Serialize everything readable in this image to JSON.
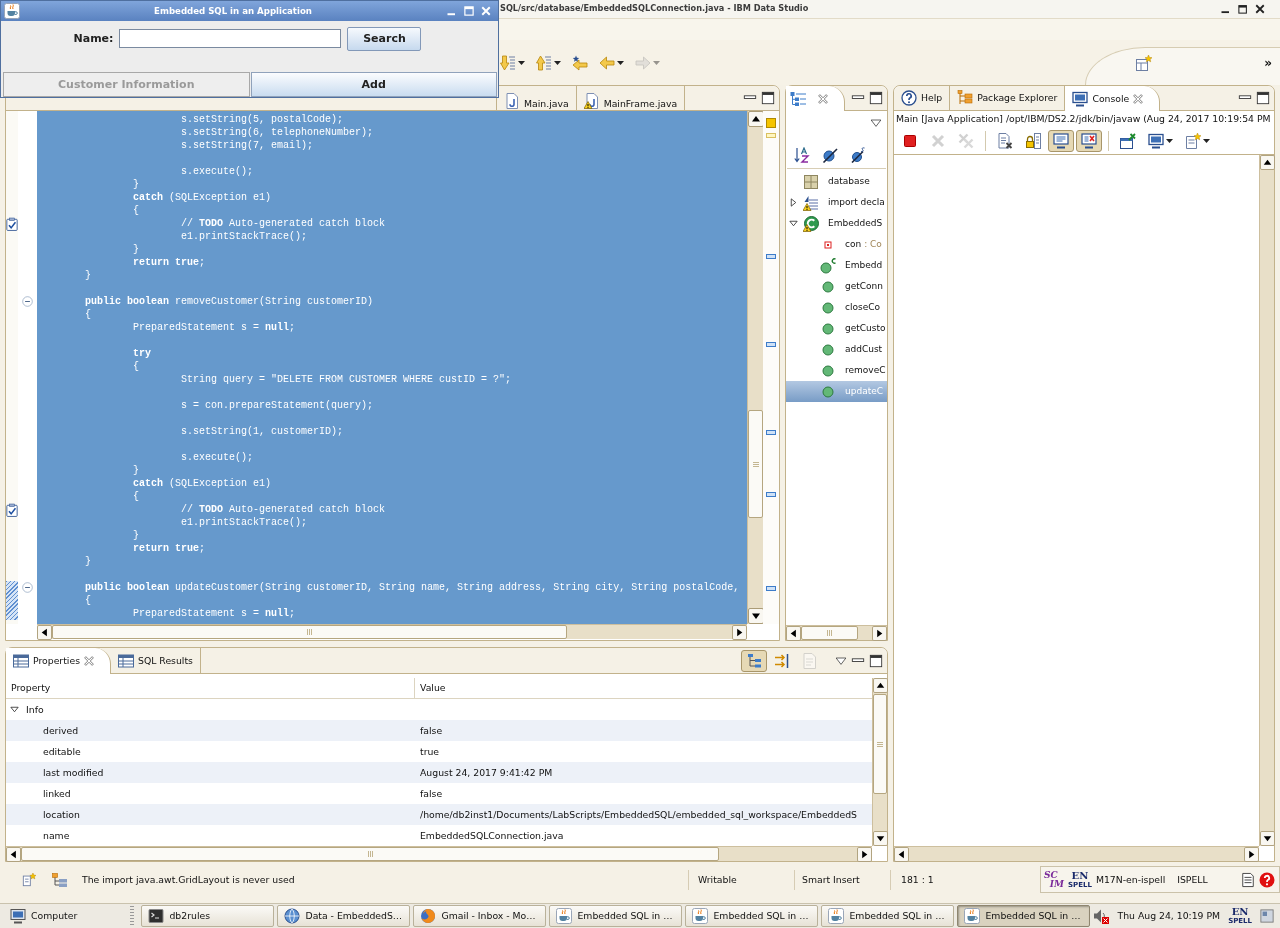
{
  "app_window": {
    "title": "Embedded SQL in an Application",
    "name_label": "Name:",
    "search_button": "Search",
    "buttons": [
      {
        "label": "Customer Information",
        "disabled": true
      },
      {
        "label": "Add",
        "disabled": false
      }
    ]
  },
  "ide": {
    "title": "SQL/src/database/EmbeddedSQLConnection.java - IBM Data Studio",
    "toolbar": [
      {
        "kind": "next-annotation",
        "dropdown": true,
        "disabled": false
      },
      {
        "kind": "previous-annotation",
        "dropdown": true,
        "disabled": false
      },
      {
        "kind": "last-edit",
        "dropdown": false,
        "disabled": false
      },
      {
        "kind": "back",
        "dropdown": true,
        "disabled": false
      },
      {
        "kind": "forward",
        "dropdown": true,
        "disabled": true
      }
    ],
    "overflow_label": "»"
  },
  "editor": {
    "tabs": [
      {
        "label": "Main.java",
        "selected": false,
        "warning": false
      },
      {
        "label": "MainFrame.java",
        "selected": false,
        "warning": true
      }
    ],
    "blocks": [
      {
        "changed": false,
        "lines": [
          {
            "kind": "code",
            "text": "\t\t\ts.setString(5, postalCode);"
          },
          {
            "kind": "code",
            "text": "\t\t\ts.setString(6, telephoneNumber);"
          },
          {
            "kind": "code",
            "text": "\t\t\ts.setString(7, email);"
          }
        ]
      },
      {
        "changed": false,
        "lines": [
          {
            "kind": "code",
            "text": "\t\t\ts.execute();"
          },
          {
            "kind": "code",
            "text": "\t\t}"
          },
          {
            "kind": "code",
            "text": "\t\t**catch** (SQLException e1)"
          },
          {
            "kind": "code",
            "text": "\t\t{"
          },
          {
            "kind": "task",
            "text": "\t\t\t// **TODO** Auto-generated catch block"
          },
          {
            "kind": "code",
            "text": "\t\t\te1.printStackTrace();"
          },
          {
            "kind": "code",
            "text": "\t\t}"
          },
          {
            "kind": "code",
            "text": "\t\t**return** **true**;"
          },
          {
            "kind": "code",
            "text": "\t}"
          }
        ]
      },
      {
        "changed": false,
        "lines": [
          {
            "kind": "fold",
            "text": "\t**public** **boolean** removeCustomer(String customerID)"
          },
          {
            "kind": "code",
            "text": "\t{"
          },
          {
            "kind": "code",
            "text": "\t\tPreparedStatement s = **null**;"
          }
        ]
      },
      {
        "changed": false,
        "lines": [
          {
            "kind": "code",
            "text": "\t\t**try**"
          },
          {
            "kind": "code",
            "text": "\t\t{"
          },
          {
            "kind": "code",
            "text": "\t\t\tString query = \"DELETE FROM CUSTOMER WHERE custID = ?\";"
          }
        ]
      },
      {
        "changed": false,
        "lines": [
          {
            "kind": "code",
            "text": "\t\t\ts = con.prepareStatement(query);"
          }
        ]
      },
      {
        "changed": false,
        "lines": [
          {
            "kind": "code",
            "text": "\t\t\ts.setString(1, customerID);"
          }
        ]
      },
      {
        "changed": false,
        "lines": [
          {
            "kind": "code",
            "text": "\t\t\ts.execute();"
          },
          {
            "kind": "code",
            "text": "\t\t}"
          },
          {
            "kind": "code",
            "text": "\t\t**catch** (SQLException e1)"
          },
          {
            "kind": "code",
            "text": "\t\t{"
          },
          {
            "kind": "task",
            "text": "\t\t\t// **TODO** Auto-generated catch block"
          },
          {
            "kind": "code",
            "text": "\t\t\te1.printStackTrace();"
          },
          {
            "kind": "code",
            "text": "\t\t}"
          },
          {
            "kind": "code",
            "text": "\t\t**return** **true**;"
          },
          {
            "kind": "code",
            "text": "\t}"
          }
        ]
      },
      {
        "changed": true,
        "lines": [
          {
            "kind": "fold",
            "text": "\t**public** **boolean** updateCustomer(String customerID, String name, String address, String city, String postalCode,"
          },
          {
            "kind": "code",
            "text": "\t{"
          },
          {
            "kind": "code",
            "text": "\t\tPreparedStatement s = **null**;"
          }
        ]
      }
    ]
  },
  "outline": {
    "tabs": [
      {
        "kind": "outline",
        "selected": true
      }
    ],
    "items": [
      {
        "kind": "package",
        "label": "database",
        "warning": false,
        "selected": false
      },
      {
        "kind": "imports",
        "label": "import decla",
        "warning": true,
        "expanded": false,
        "selected": false
      },
      {
        "kind": "class",
        "label": "EmbeddedS",
        "warning": true,
        "expanded": true,
        "selected": false,
        "children": [
          {
            "kind": "field",
            "label": "con",
            "detail": ": Co",
            "selected": false
          },
          {
            "kind": "constructor",
            "label": "Embedd",
            "selected": false
          },
          {
            "kind": "method",
            "label": "getConn",
            "selected": false
          },
          {
            "kind": "method",
            "label": "closeCo",
            "selected": false
          },
          {
            "kind": "method",
            "label": "getCusto",
            "selected": false
          },
          {
            "kind": "method",
            "label": "addCust",
            "selected": false
          },
          {
            "kind": "method",
            "label": "removeC",
            "selected": false
          },
          {
            "kind": "method",
            "label": "updateC",
            "selected": true
          }
        ]
      }
    ]
  },
  "console": {
    "tabs": [
      {
        "kind": "help",
        "label": "Help",
        "selected": false
      },
      {
        "kind": "package-explorer",
        "label": "Package Explorer",
        "selected": false
      },
      {
        "kind": "console",
        "label": "Console",
        "selected": true
      }
    ],
    "process": "Main [Java Application] /opt/IBM/DS2.2/jdk/bin/javaw (Aug 24, 2017 10:19:54 PM",
    "toolbar_groups": [
      [
        {
          "kind": "terminate",
          "pressed": false,
          "disabled": false,
          "dropdown": false
        },
        {
          "kind": "remove-launch",
          "pressed": false,
          "disabled": true,
          "dropdown": false
        },
        {
          "kind": "remove-all",
          "pressed": false,
          "disabled": true,
          "dropdown": false
        }
      ],
      [
        {
          "kind": "clear",
          "pressed": false,
          "disabled": false,
          "dropdown": false
        },
        {
          "kind": "scroll-lock",
          "pressed": false,
          "disabled": false,
          "dropdown": false
        },
        {
          "kind": "show-on-output",
          "pressed": true,
          "disabled": false,
          "dropdown": false
        },
        {
          "kind": "show-on-error",
          "pressed": true,
          "disabled": false,
          "dropdown": false
        }
      ],
      [
        {
          "kind": "pin",
          "pressed": false,
          "disabled": false,
          "dropdown": false
        },
        {
          "kind": "display-console",
          "pressed": false,
          "disabled": false,
          "dropdown": true
        },
        {
          "kind": "open-console",
          "pressed": false,
          "disabled": false,
          "dropdown": true
        }
      ]
    ]
  },
  "properties": {
    "tabs": [
      {
        "label": "Properties",
        "selected": true
      },
      {
        "label": "SQL Results",
        "selected": false
      }
    ],
    "toolbar": [
      {
        "kind": "show-categories",
        "pressed": true,
        "disabled": false
      },
      {
        "kind": "show-advanced",
        "pressed": false,
        "disabled": false
      },
      {
        "kind": "restore-default",
        "pressed": false,
        "disabled": true
      }
    ],
    "columns": [
      "Property",
      "Value"
    ],
    "groups": [
      {
        "label": "Info",
        "expanded": true,
        "rows": [
          {
            "property": "derived",
            "value": "false"
          },
          {
            "property": "editable",
            "value": "true"
          },
          {
            "property": "last modified",
            "value": "August 24, 2017 9:41:42 PM"
          },
          {
            "property": "linked",
            "value": "false"
          },
          {
            "property": "location",
            "value": "/home/db2inst1/Documents/LabScripts/EmbeddedSQL/embedded_sql_workspace/EmbeddedS"
          },
          {
            "property": "name",
            "value": "EmbeddedSQLConnection.java"
          }
        ]
      }
    ]
  },
  "status_bar": {
    "message": "The import java.awt.GridLayout is never used",
    "fields": [
      "Writable",
      "Smart Insert",
      "181 : 1"
    ],
    "input_method": {
      "logo": [
        "SC",
        "IM"
      ],
      "spell_badge": [
        "EN",
        "SPELL"
      ],
      "labels": [
        "M17N-en-ispell",
        "ISPELL"
      ]
    }
  },
  "taskbar": {
    "launcher": "Computer",
    "tasks": [
      {
        "kind": "terminal",
        "label": "db2rules",
        "selected": false
      },
      {
        "kind": "data-studio",
        "label": "Data - EmbeddedS…",
        "selected": false
      },
      {
        "kind": "browser",
        "label": "Gmail - Inbox - Mo…",
        "selected": false
      },
      {
        "kind": "java",
        "label": "Embedded SQL in …",
        "selected": false
      },
      {
        "kind": "java",
        "label": "Embedded SQL in …",
        "selected": false
      },
      {
        "kind": "java",
        "label": "Embedded SQL in …",
        "selected": false
      },
      {
        "kind": "java",
        "label": "Embedded SQL in …",
        "selected": true
      }
    ],
    "volume_muted": true,
    "clock": "Thu Aug 24, 10:19 PM",
    "spell_badge": [
      "EN",
      "SPELL"
    ]
  }
}
